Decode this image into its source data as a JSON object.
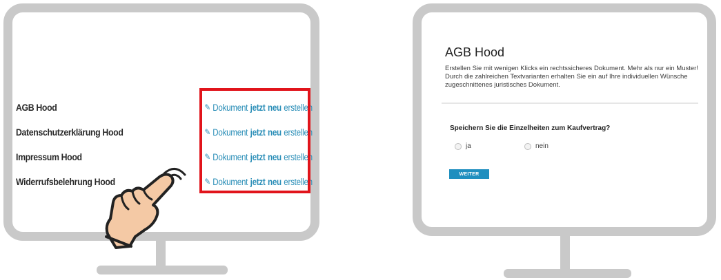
{
  "left_screen": {
    "documents": [
      {
        "name": "AGB Hood"
      },
      {
        "name": "Datenschutzerklärung Hood"
      },
      {
        "name": "Impressum Hood"
      },
      {
        "name": "Widerrufsbelehrung Hood"
      }
    ],
    "link": {
      "part1": "Dokument",
      "part2": "jetzt",
      "part3": "neu",
      "part4": "erstellen",
      "icon": "pencil-icon"
    },
    "highlight_color": "#e1141b"
  },
  "right_screen": {
    "title": "AGB Hood",
    "description": "Erstellen Sie mit wenigen Klicks ein rechtssicheres Dokument. Mehr als nur ein Muster! Durch die zahlreichen Textvarianten erhalten Sie ein auf Ihre individuellen Wünsche zugeschnittenes juristisches Dokument.",
    "question": "Speichern Sie die Einzelheiten zum Kaufvertrag?",
    "options": [
      "ja",
      "nein"
    ],
    "button_label": "WEITER",
    "accent_color": "#1f8fbf"
  }
}
